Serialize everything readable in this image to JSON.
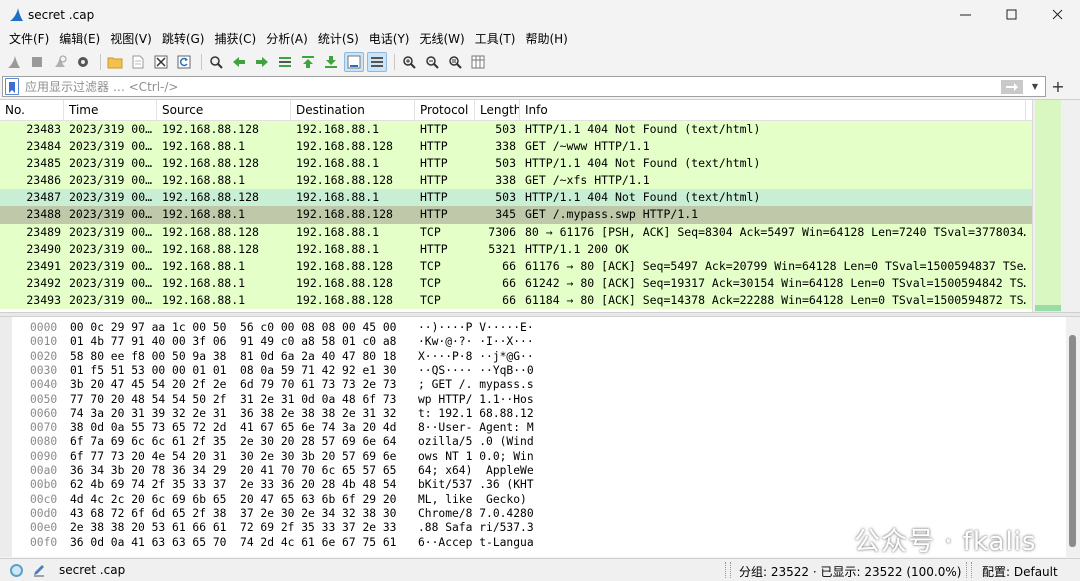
{
  "window": {
    "title": "secret .cap"
  },
  "menu": [
    "文件(F)",
    "编辑(E)",
    "视图(V)",
    "跳转(G)",
    "捕获(C)",
    "分析(A)",
    "统计(S)",
    "电话(Y)",
    "无线(W)",
    "工具(T)",
    "帮助(H)"
  ],
  "filter": {
    "placeholder": "应用显示过滤器 … <Ctrl-/>",
    "value": ""
  },
  "columns": [
    "No.",
    "Time",
    "Source",
    "Destination",
    "Protocol",
    "Length",
    "Info"
  ],
  "packets": [
    {
      "no": "23483",
      "time": "2023/319 00…",
      "src": "192.168.88.128",
      "dst": "192.168.88.1",
      "proto": "HTTP",
      "len": "503",
      "info": "HTTP/1.1 404 Not Found  (text/html)",
      "bg": "#e4ffc7"
    },
    {
      "no": "23484",
      "time": "2023/319 00…",
      "src": "192.168.88.1",
      "dst": "192.168.88.128",
      "proto": "HTTP",
      "len": "338",
      "info": "GET /~www HTTP/1.1",
      "bg": "#e4ffc7"
    },
    {
      "no": "23485",
      "time": "2023/319 00…",
      "src": "192.168.88.128",
      "dst": "192.168.88.1",
      "proto": "HTTP",
      "len": "503",
      "info": "HTTP/1.1 404 Not Found  (text/html)",
      "bg": "#e4ffc7"
    },
    {
      "no": "23486",
      "time": "2023/319 00…",
      "src": "192.168.88.1",
      "dst": "192.168.88.128",
      "proto": "HTTP",
      "len": "338",
      "info": "GET /~xfs HTTP/1.1",
      "bg": "#e4ffc7"
    },
    {
      "no": "23487",
      "time": "2023/319 00…",
      "src": "192.168.88.128",
      "dst": "192.168.88.1",
      "proto": "HTTP",
      "len": "503",
      "info": "HTTP/1.1 404 Not Found  (text/html)",
      "bg": "#c8efd4"
    },
    {
      "no": "23488",
      "time": "2023/319 00…",
      "src": "192.168.88.1",
      "dst": "192.168.88.128",
      "proto": "HTTP",
      "len": "345",
      "info": "GET /.mypass.swp HTTP/1.1",
      "bg": "#bfc9a9"
    },
    {
      "no": "23489",
      "time": "2023/319 00…",
      "src": "192.168.88.128",
      "dst": "192.168.88.1",
      "proto": "TCP",
      "len": "7306",
      "info": "80 → 61176 [PSH, ACK] Seq=8304 Ack=5497 Win=64128 Len=7240 TSval=3778034…",
      "bg": "#e4ffc7"
    },
    {
      "no": "23490",
      "time": "2023/319 00…",
      "src": "192.168.88.128",
      "dst": "192.168.88.1",
      "proto": "HTTP",
      "len": "5321",
      "info": "HTTP/1.1 200 OK",
      "bg": "#e4ffc7"
    },
    {
      "no": "23491",
      "time": "2023/319 00…",
      "src": "192.168.88.1",
      "dst": "192.168.88.128",
      "proto": "TCP",
      "len": "66",
      "info": "61176 → 80 [ACK] Seq=5497 Ack=20799 Win=64128 Len=0 TSval=1500594837 TSe…",
      "bg": "#e4ffc7"
    },
    {
      "no": "23492",
      "time": "2023/319 00…",
      "src": "192.168.88.1",
      "dst": "192.168.88.128",
      "proto": "TCP",
      "len": "66",
      "info": "61242 → 80 [ACK] Seq=19317 Ack=30154 Win=64128 Len=0 TSval=1500594842 TS…",
      "bg": "#e4ffc7"
    },
    {
      "no": "23493",
      "time": "2023/319 00…",
      "src": "192.168.88.1",
      "dst": "192.168.88.128",
      "proto": "TCP",
      "len": "66",
      "info": "61184 → 80 [ACK] Seq=14378 Ack=22288 Win=64128 Len=0 TSval=1500594872 TS…",
      "bg": "#e4ffc7"
    }
  ],
  "hex": [
    {
      "off": "0000",
      "bytes": "00 0c 29 97 aa 1c 00 50  56 c0 00 08 08 00 45 00",
      "ascii": "··)····P V·····E·"
    },
    {
      "off": "0010",
      "bytes": "01 4b 77 91 40 00 3f 06  91 49 c0 a8 58 01 c0 a8",
      "ascii": "·Kw·@·?· ·I··X···"
    },
    {
      "off": "0020",
      "bytes": "58 80 ee f8 00 50 9a 38  81 0d 6a 2a 40 47 80 18",
      "ascii": "X····P·8 ··j*@G··"
    },
    {
      "off": "0030",
      "bytes": "01 f5 51 53 00 00 01 01  08 0a 59 71 42 92 e1 30",
      "ascii": "··QS···· ··YqB··0"
    },
    {
      "off": "0040",
      "bytes": "3b 20 47 45 54 20 2f 2e  6d 79 70 61 73 73 2e 73",
      "ascii": "; GET /. mypass.s"
    },
    {
      "off": "0050",
      "bytes": "77 70 20 48 54 54 50 2f  31 2e 31 0d 0a 48 6f 73",
      "ascii": "wp HTTP/ 1.1··Hos"
    },
    {
      "off": "0060",
      "bytes": "74 3a 20 31 39 32 2e 31  36 38 2e 38 38 2e 31 32",
      "ascii": "t: 192.1 68.88.12"
    },
    {
      "off": "0070",
      "bytes": "38 0d 0a 55 73 65 72 2d  41 67 65 6e 74 3a 20 4d",
      "ascii": "8··User- Agent: M"
    },
    {
      "off": "0080",
      "bytes": "6f 7a 69 6c 6c 61 2f 35  2e 30 20 28 57 69 6e 64",
      "ascii": "ozilla/5 .0 (Wind"
    },
    {
      "off": "0090",
      "bytes": "6f 77 73 20 4e 54 20 31  30 2e 30 3b 20 57 69 6e",
      "ascii": "ows NT 1 0.0; Win"
    },
    {
      "off": "00a0",
      "bytes": "36 34 3b 20 78 36 34 29  20 41 70 70 6c 65 57 65",
      "ascii": "64; x64)  AppleWe"
    },
    {
      "off": "00b0",
      "bytes": "62 4b 69 74 2f 35 33 37  2e 33 36 20 28 4b 48 54",
      "ascii": "bKit/537 .36 (KHT"
    },
    {
      "off": "00c0",
      "bytes": "4d 4c 2c 20 6c 69 6b 65  20 47 65 63 6b 6f 29 20",
      "ascii": "ML, like  Gecko) "
    },
    {
      "off": "00d0",
      "bytes": "43 68 72 6f 6d 65 2f 38  37 2e 30 2e 34 32 38 30",
      "ascii": "Chrome/8 7.0.4280"
    },
    {
      "off": "00e0",
      "bytes": "2e 38 38 20 53 61 66 61  72 69 2f 35 33 37 2e 33",
      "ascii": ".88 Safa ri/537.3"
    },
    {
      "off": "00f0",
      "bytes": "36 0d 0a 41 63 63 65 70  74 2d 4c 61 6e 67 75 61",
      "ascii": "6··Accep t-Langua"
    }
  ],
  "status": {
    "file": "secret .cap",
    "packets": "分组: 23522 · 已显示: 23522 (100.0%)",
    "profile": "配置: Default"
  },
  "watermark": {
    "text": "公众号 · fkalis"
  },
  "colors": {
    "http_row": "#e4ffc7",
    "selected_row": "#bfc9a9",
    "related_row": "#c8efd4"
  }
}
